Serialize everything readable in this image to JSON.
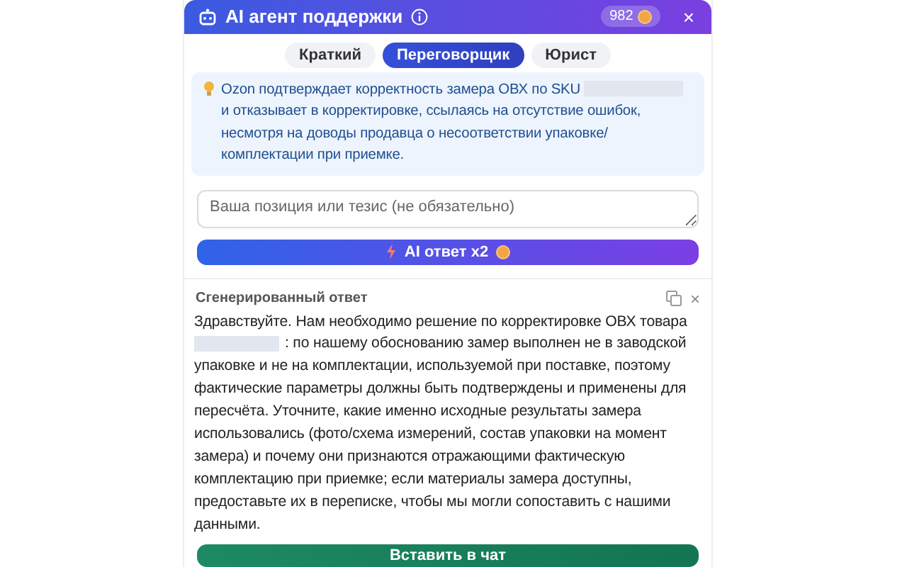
{
  "header": {
    "title": "AI агент поддержки",
    "balance": "982",
    "close": "×"
  },
  "tabs": [
    {
      "label": "Краткий",
      "selected": false
    },
    {
      "label": "Переговорщик",
      "selected": true
    },
    {
      "label": "Юрист",
      "selected": false
    }
  ],
  "summary": {
    "parts": [
      "Ozon подтверждает корректность замера ОВХ по SKU",
      "и отказывает в корректировке, ссылаясь на отсутствие ошибок, несмотря на доводы продавца о несоответствии упаковке/ комплектации при приемке."
    ]
  },
  "thesis": {
    "placeholder": "Ваша позиция или тезис (не обязательно)"
  },
  "generate_button": {
    "label": "AI ответ x2"
  },
  "result": {
    "title": "Сгенерированный ответ",
    "close": "×",
    "parts": [
      "Здравствуйте. Нам необходимо решение по корректировке ОВХ товара",
      ": по нашему обоснованию замер выполнен не в заводской упаковке и не на комплектации, используемой при поставке, поэтому фактические параметры должны быть подтверждены и применены для пересчёта. Уточните, какие именно исходные результаты замера использовались (фото/схема измерений, состав упаковки на момент замера) и почему они признаются отражающими фактическую комплектацию при приемке; если материалы замера доступны, предоставьте их в переписке, чтобы мы могли сопоставить с нашими данными."
    ]
  },
  "insert_button": {
    "label": "Вставить в чат"
  }
}
